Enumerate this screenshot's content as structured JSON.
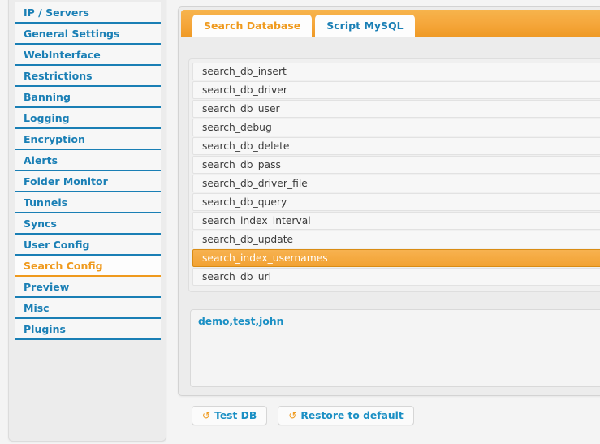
{
  "sidebar": {
    "items": [
      {
        "label": "IP / Servers",
        "active": false
      },
      {
        "label": "General Settings",
        "active": false
      },
      {
        "label": "WebInterface",
        "active": false
      },
      {
        "label": "Restrictions",
        "active": false
      },
      {
        "label": "Banning",
        "active": false
      },
      {
        "label": "Logging",
        "active": false
      },
      {
        "label": "Encryption",
        "active": false
      },
      {
        "label": "Alerts",
        "active": false
      },
      {
        "label": "Folder Monitor",
        "active": false
      },
      {
        "label": "Tunnels",
        "active": false
      },
      {
        "label": "Syncs",
        "active": false
      },
      {
        "label": "User Config",
        "active": false
      },
      {
        "label": "Search Config",
        "active": true
      },
      {
        "label": "Preview",
        "active": false
      },
      {
        "label": "Misc",
        "active": false
      },
      {
        "label": "Plugins",
        "active": false
      }
    ]
  },
  "tabs": [
    {
      "label": "Search Database",
      "active": true
    },
    {
      "label": "Script MySQL",
      "active": false
    }
  ],
  "options": [
    {
      "label": "search_db_insert",
      "selected": false
    },
    {
      "label": "search_db_driver",
      "selected": false
    },
    {
      "label": "search_db_user",
      "selected": false
    },
    {
      "label": "search_debug",
      "selected": false
    },
    {
      "label": "search_db_delete",
      "selected": false
    },
    {
      "label": "search_db_pass",
      "selected": false
    },
    {
      "label": "search_db_driver_file",
      "selected": false
    },
    {
      "label": "search_db_query",
      "selected": false
    },
    {
      "label": "search_index_interval",
      "selected": false
    },
    {
      "label": "search_db_update",
      "selected": false
    },
    {
      "label": "search_index_usernames",
      "selected": true
    },
    {
      "label": "search_db_url",
      "selected": false
    }
  ],
  "value_editor": {
    "value": "demo,test,john",
    "placeholder": ""
  },
  "buttons": [
    {
      "label": "Test DB",
      "icon": "refresh-icon",
      "glyph": "↺"
    },
    {
      "label": "Restore to default",
      "icon": "restore-icon",
      "glyph": "↺"
    }
  ],
  "colors": {
    "accent_orange": "#ef9a1e",
    "link_blue": "#1a7fb5",
    "panel_gray": "#ececec",
    "selected_row": "#f2a233"
  }
}
